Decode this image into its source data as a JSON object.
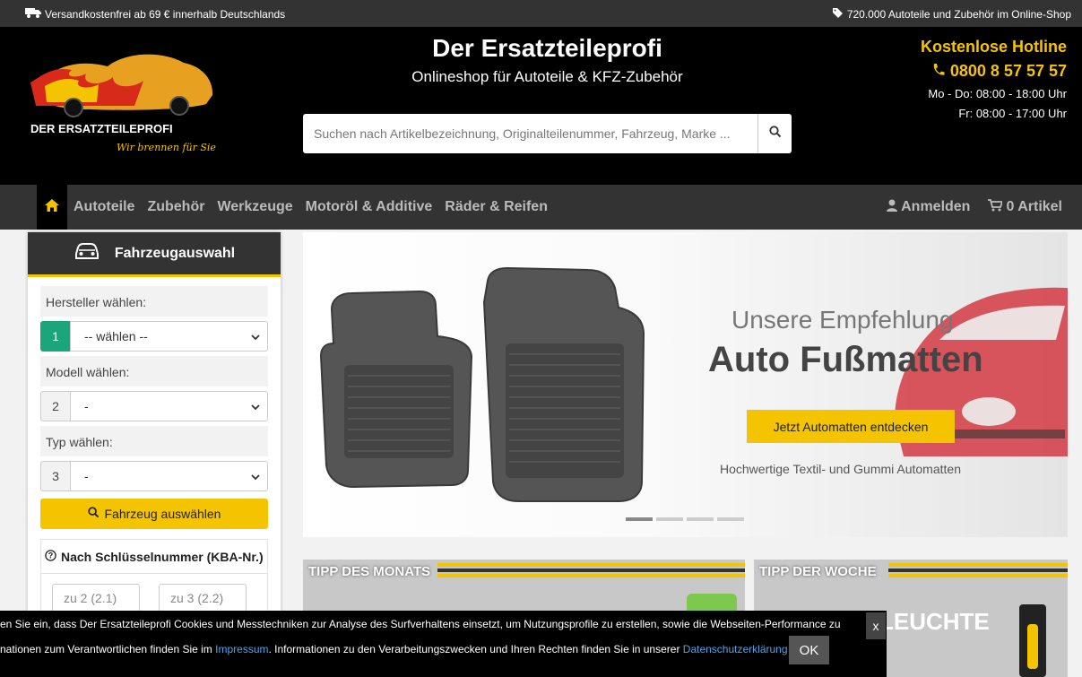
{
  "topbar": {
    "shipping": "Versandkostenfrei ab 69 € innerhalb Deutschlands",
    "catalog": "720.000 Autoteile und Zubehör im Online-Shop"
  },
  "header": {
    "logo_text": "DER ERSATZTEILEPROFI",
    "logo_slogan": "Wir brennen für Sie.",
    "title": "Der Ersatzteileprofi",
    "subtitle": "Onlineshop für Autoteile & KFZ-Zubehör",
    "search_placeholder": "Suchen nach Artikelbezeichnung, Originalteilenummer, Fahrzeug, Marke ...",
    "hotline_title": "Kostenlose Hotline",
    "hotline_phone": "0800 8 57 57 57",
    "hours_weekday": "Mo - Do: 08:00 - 18:00 Uhr",
    "hours_friday": "Fr: 08:00 - 17:00 Uhr"
  },
  "nav": {
    "items": [
      "Autoteile",
      "Zubehör",
      "Werkzeuge",
      "Motoröl & Additive",
      "Räder & Reifen"
    ],
    "login": "Anmelden",
    "cart": "0 Artikel"
  },
  "vehicle": {
    "title": "Fahrzeugauswahl",
    "manufacturer_label": "Hersteller wählen:",
    "manufacturer_value": "-- wählen --",
    "model_label": "Modell wählen:",
    "model_value": "-",
    "type_label": "Typ wählen:",
    "type_value": "-",
    "steps": [
      "1",
      "2",
      "3"
    ],
    "submit": "Fahrzeug auswählen",
    "kba_title": "Nach Schlüsselnummer (KBA-Nr.)",
    "kba_field1": "zu 2 (2.1)",
    "kba_field2": "zu 3 (2.2)"
  },
  "hero": {
    "kicker": "Unsere Empfehlung",
    "headline": "Auto Fußmatten",
    "cta": "Jetzt Automatten entdecken",
    "tagline": "Hochwertige Textil- und Gummi Automatten",
    "active_slide": 1,
    "slide_count": 4
  },
  "tiles": {
    "month": "TIPP DES MONATS",
    "week": "TIPP DER WOCHE",
    "week_overlay": "LEUCHTE"
  },
  "cookie": {
    "line1": "en Sie ein, dass Der Ersatzteileprofi Cookies und Messtechniken zur Analyse des Surfverhaltens einsetzt, um Nutzungsprofile zu erstellen, sowie die Webseiten-Performance zu",
    "line2_pre": "nationen zum Verantwortlichen finden Sie im ",
    "link_impressum": "Impressum",
    "line2_mid": ". Informationen zu den Verarbeitungszwecken und Ihren Rechten finden Sie in unserer ",
    "link_privacy": "Datenschutzerklärung",
    "ok": "OK",
    "close": "x"
  },
  "colors": {
    "accent": "#f5c400",
    "step_active": "#1aa67a",
    "link": "#4ea3e6"
  }
}
